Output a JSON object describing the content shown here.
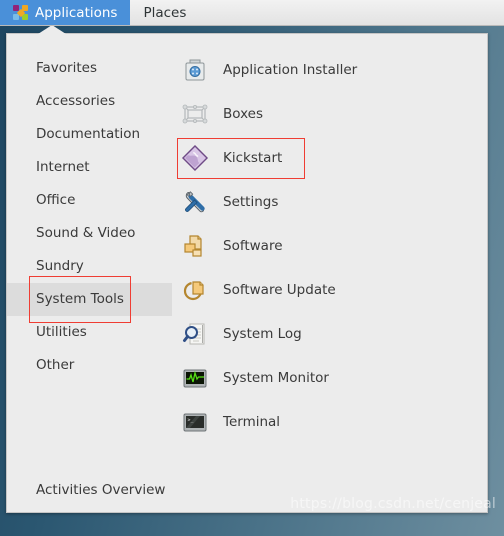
{
  "topbar": {
    "logo_icon": "centos-logo-icon",
    "applications_label": "Applications",
    "places_label": "Places"
  },
  "menu": {
    "categories": [
      {
        "label": "Favorites",
        "selected": false
      },
      {
        "label": "Accessories",
        "selected": false
      },
      {
        "label": "Documentation",
        "selected": false
      },
      {
        "label": "Internet",
        "selected": false
      },
      {
        "label": "Office",
        "selected": false
      },
      {
        "label": "Sound & Video",
        "selected": false
      },
      {
        "label": "Sundry",
        "selected": false
      },
      {
        "label": "System Tools",
        "selected": true
      },
      {
        "label": "Utilities",
        "selected": false
      },
      {
        "label": "Other",
        "selected": false
      }
    ],
    "activities_label": "Activities Overview",
    "applications": [
      {
        "label": "Application Installer",
        "icon": "package-installer-icon",
        "highlighted": false
      },
      {
        "label": "Boxes",
        "icon": "boxes-icon",
        "highlighted": false
      },
      {
        "label": "Kickstart",
        "icon": "kickstart-icon",
        "highlighted": true
      },
      {
        "label": "Settings",
        "icon": "tools-settings-icon",
        "highlighted": false
      },
      {
        "label": "Software",
        "icon": "software-icon",
        "highlighted": false
      },
      {
        "label": "Software Update",
        "icon": "software-update-icon",
        "highlighted": false
      },
      {
        "label": "System Log",
        "icon": "system-log-icon",
        "highlighted": false
      },
      {
        "label": "System Monitor",
        "icon": "system-monitor-icon",
        "highlighted": false
      },
      {
        "label": "Terminal",
        "icon": "terminal-icon",
        "highlighted": false
      }
    ]
  },
  "watermark": {
    "text": "https://blog.csdn.net/cenjeal"
  },
  "colors": {
    "accent_blue": "#4a90d9",
    "annotation_red": "#ef3d33",
    "panel_bg": "#ececec",
    "selected_row": "#dcdcdc",
    "desktop_dark": "#1d4560"
  }
}
